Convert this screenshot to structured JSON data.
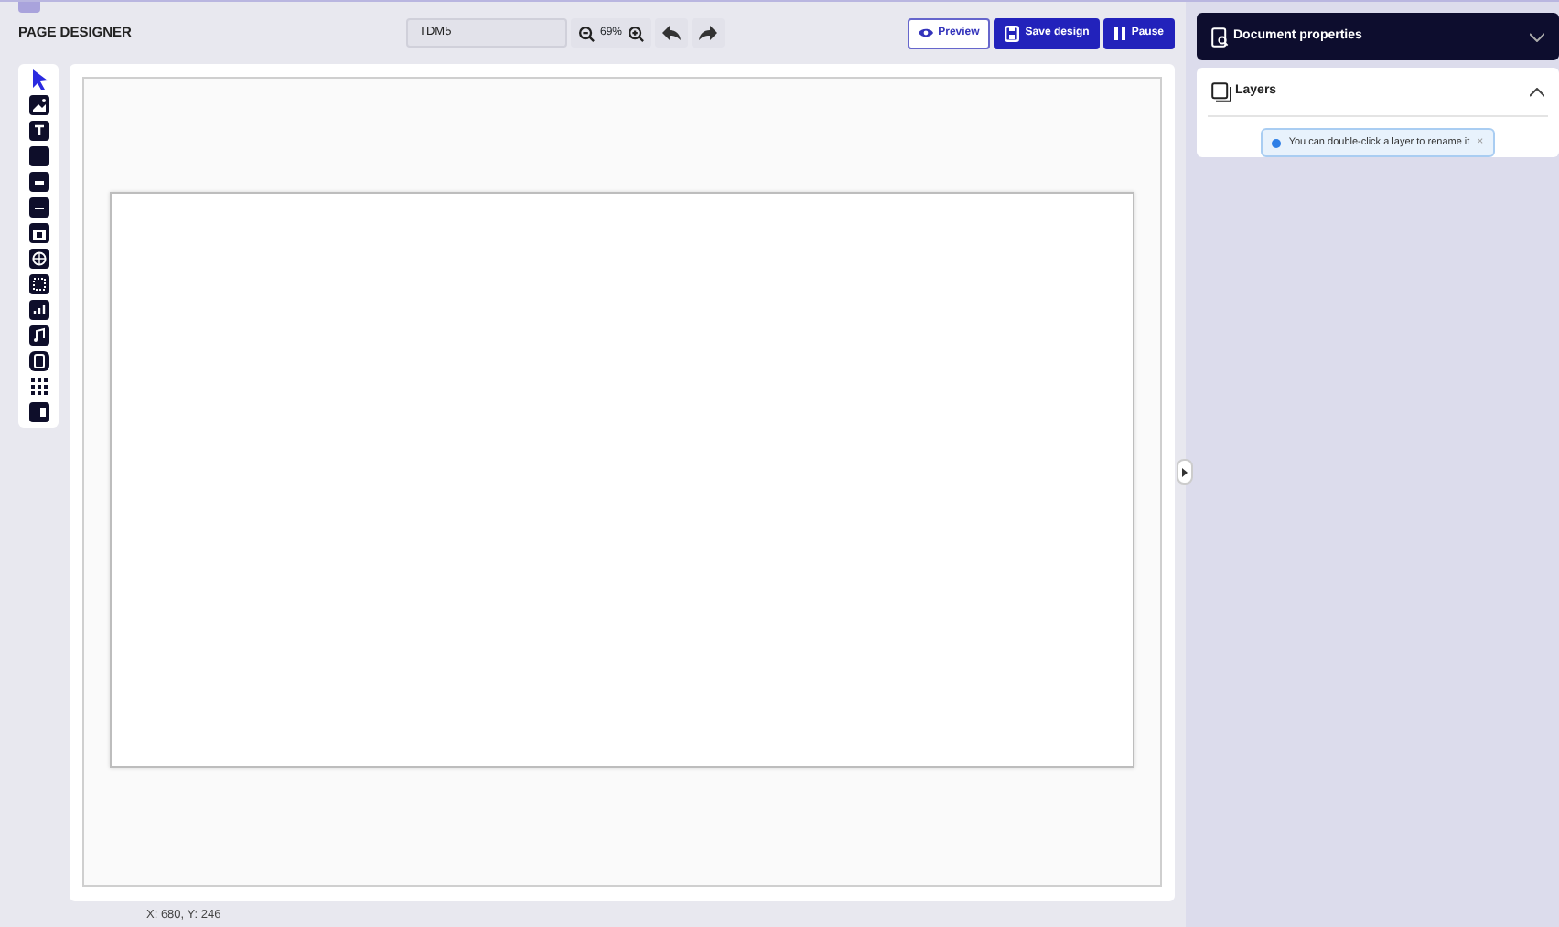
{
  "app_title": "PAGE DESIGNER",
  "document_name": {
    "value": "TDM5"
  },
  "zoom": {
    "level_text": "69%"
  },
  "actions": [
    {
      "kind": "outline",
      "label": "Preview"
    },
    {
      "kind": "primary",
      "label": "Save design"
    },
    {
      "kind": "primary",
      "label": "Pause"
    }
  ],
  "tools": [
    {
      "kind": "pointer",
      "selected": true
    },
    {
      "kind": "image",
      "selected": false
    },
    {
      "kind": "text",
      "selected": false
    },
    {
      "kind": "square",
      "selected": false
    },
    {
      "kind": "badge",
      "selected": false
    },
    {
      "kind": "keyboard",
      "selected": false
    },
    {
      "kind": "calendar",
      "selected": false
    },
    {
      "kind": "globe",
      "selected": false
    },
    {
      "kind": "frame",
      "selected": false
    },
    {
      "kind": "chart",
      "selected": false
    },
    {
      "kind": "music",
      "selected": false
    },
    {
      "kind": "video",
      "selected": false
    },
    {
      "kind": "grid",
      "selected": false
    },
    {
      "kind": "card",
      "selected": false
    }
  ],
  "coordinates": "X: 680, Y: 246",
  "panels": [
    {
      "title": "Document properties",
      "expanded": false,
      "dark": true
    },
    {
      "title": "Layers",
      "expanded": true,
      "dark": false,
      "tip": "You can double-click a layer to rename it",
      "tip_close": "×"
    }
  ]
}
